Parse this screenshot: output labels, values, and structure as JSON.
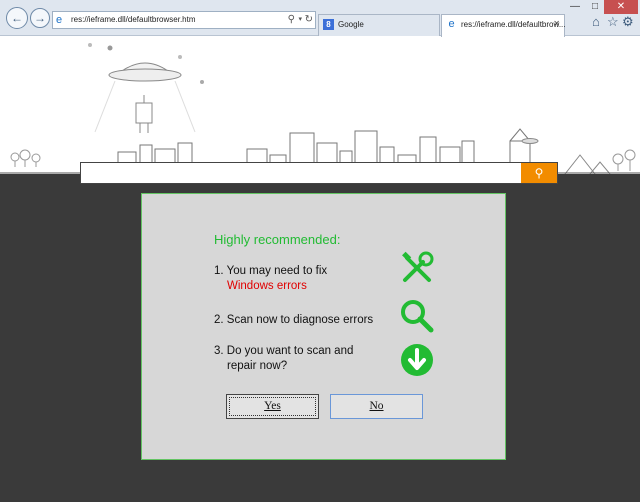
{
  "browser": {
    "address_url": "res://ieframe.dll/defaultbrowser.htm",
    "nav_back_icon": "arrow-left-icon",
    "nav_forward_icon": "arrow-right-icon",
    "tabs": [
      {
        "label": "Google",
        "icon": "google-favicon"
      },
      {
        "label": "res://ieframe.dll/defaultbrow...",
        "icon": "ie-favicon",
        "active": true
      }
    ],
    "window_controls": [
      "minimize",
      "maximize",
      "close"
    ],
    "toolbar_icons": [
      "home-icon",
      "star-icon",
      "gear-icon"
    ]
  },
  "page": {
    "search_placeholder": "",
    "search_button_icon": "search-icon",
    "search_button_color": "#f28c00"
  },
  "dialog": {
    "title": "Highly recommended:",
    "items": [
      {
        "line1": "1. You may need to fix",
        "line2": "Windows errors",
        "icon": "tools-icon"
      },
      {
        "line1": "2. Scan now to diagnose errors",
        "icon": "magnifier-icon"
      },
      {
        "line1": "3. Do you want to scan and",
        "line2": "repair now?",
        "icon": "download-arrow-icon"
      }
    ],
    "yes_label": "Yes",
    "no_label": "No",
    "accent_color": "#22bb33",
    "warning_color": "#e00000"
  }
}
